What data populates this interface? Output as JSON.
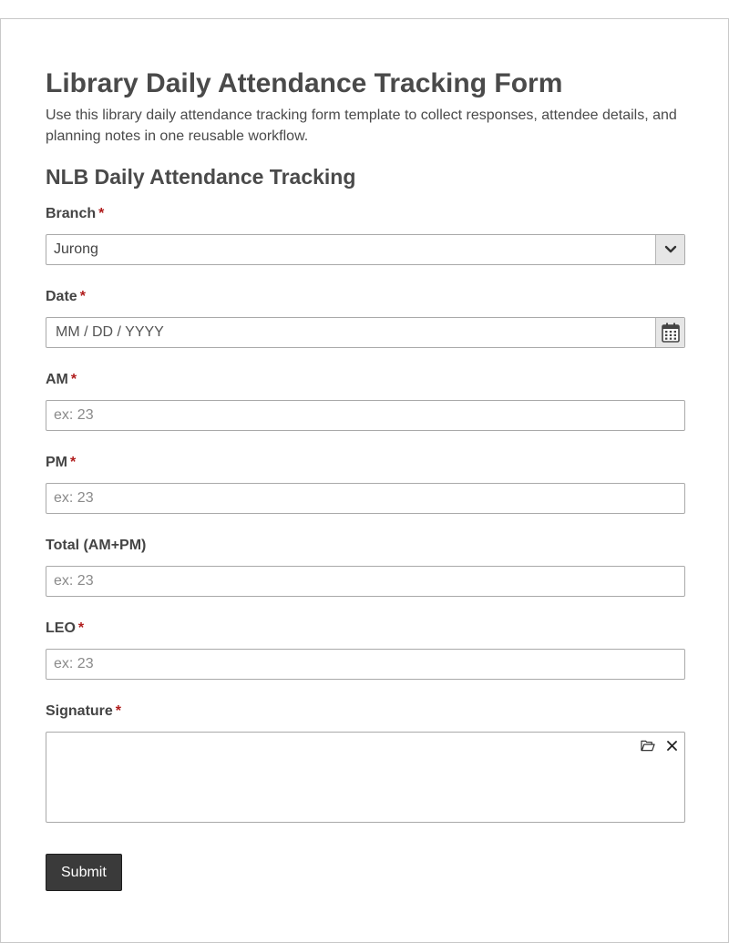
{
  "form": {
    "title": "Library Daily Attendance Tracking Form",
    "description": "Use this library daily attendance tracking form template to collect responses, attendee details, and planning notes in one reusable workflow.",
    "section_title": "NLB Daily Attendance Tracking",
    "required_mark": "*",
    "fields": {
      "branch": {
        "label": "Branch",
        "value": "Jurong"
      },
      "date": {
        "label": "Date",
        "placeholder": "MM / DD / YYYY"
      },
      "am": {
        "label": "AM",
        "placeholder": "ex: 23"
      },
      "pm": {
        "label": "PM",
        "placeholder": "ex: 23"
      },
      "total": {
        "label": "Total (AM+PM)",
        "placeholder": "ex: 23"
      },
      "leo": {
        "label": "LEO",
        "placeholder": "ex: 23"
      },
      "signature": {
        "label": "Signature"
      }
    },
    "submit_label": "Submit"
  },
  "icons": {
    "branch_dropdown": "chevron-down-icon",
    "date_picker": "calendar-icon",
    "signature_upload": "folder-open-icon",
    "signature_clear": "close-icon"
  },
  "colors": {
    "required": "#b01c1c",
    "submit_bg": "#3a3a3a",
    "text": "#444444"
  }
}
